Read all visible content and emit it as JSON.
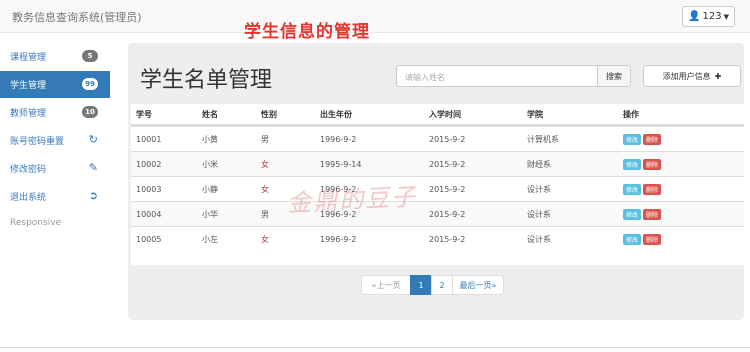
{
  "header": {
    "brand": "教务信息查询系统(管理员)",
    "overlay_title": "学生信息的管理",
    "user_label": "123"
  },
  "sidebar": {
    "items": [
      {
        "label": "课程管理",
        "badge": "5"
      },
      {
        "label": "学生管理",
        "badge": "99"
      },
      {
        "label": "教师管理",
        "badge": "10"
      },
      {
        "label": "账号密码重置",
        "icon": "refresh-icon"
      },
      {
        "label": "修改密码",
        "icon": "pencil-icon"
      },
      {
        "label": "退出系统",
        "icon": "logout-icon"
      }
    ],
    "footer": "Responsive"
  },
  "main": {
    "title": "学生名单管理",
    "search_placeholder": "请输入姓名",
    "search_button": "搜索",
    "add_button": "添加用户信息"
  },
  "table": {
    "headers": [
      "学号",
      "姓名",
      "性别",
      "出生年份",
      "入学时间",
      "学院",
      "操作"
    ],
    "rows": [
      [
        "10001",
        "小黄",
        "男",
        "1996-9-2",
        "2015-9-2",
        "计算机系"
      ],
      [
        "10002",
        "小米",
        "女",
        "1995-9-14",
        "2015-9-2",
        "财经系"
      ],
      [
        "10003",
        "小静",
        "女",
        "1996-9-2",
        "2015-9-2",
        "设计系"
      ],
      [
        "10004",
        "小华",
        "男",
        "1996-9-2",
        "2015-9-2",
        "设计系"
      ],
      [
        "10005",
        "小左",
        "女",
        "1996-9-2",
        "2015-9-2",
        "设计系"
      ]
    ],
    "edit_label": "修改",
    "delete_label": "删除"
  },
  "watermark": "金鼎的豆子",
  "pagination": {
    "prev": "«上一页",
    "pages": [
      "1",
      "2"
    ],
    "last": "最后一页»"
  },
  "colors": {
    "primary": "#337ab7",
    "edit": "#5bc0de",
    "delete": "#d9534f",
    "overlay_red": "#e8342e"
  }
}
